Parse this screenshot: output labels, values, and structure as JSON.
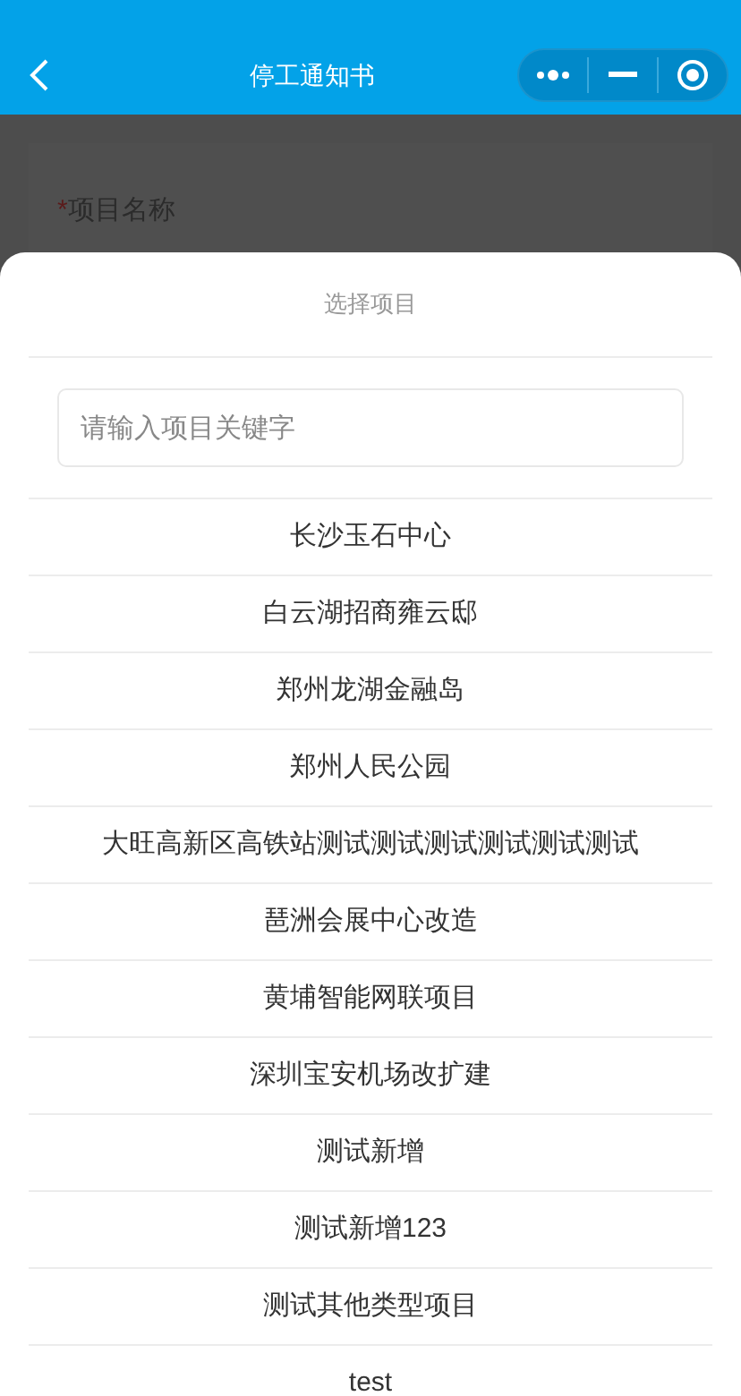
{
  "nav_bar": {
    "title": "停工通知书"
  },
  "background_form": {
    "required_mark": "*",
    "field_label": "项目名称"
  },
  "sheet": {
    "title": "选择项目",
    "search": {
      "placeholder": "请输入项目关键字"
    },
    "items": [
      {
        "label": "长沙玉石中心"
      },
      {
        "label": "白云湖招商雍云邸"
      },
      {
        "label": "郑州龙湖金融岛"
      },
      {
        "label": "郑州人民公园"
      },
      {
        "label": "大旺高新区高铁站测试测试测试测试测试测试"
      },
      {
        "label": "琶洲会展中心改造"
      },
      {
        "label": "黄埔智能网联项目"
      },
      {
        "label": "深圳宝安机场改扩建"
      },
      {
        "label": "测试新增"
      },
      {
        "label": "测试新增123"
      },
      {
        "label": "测试其他类型项目"
      },
      {
        "label": "test"
      }
    ]
  }
}
